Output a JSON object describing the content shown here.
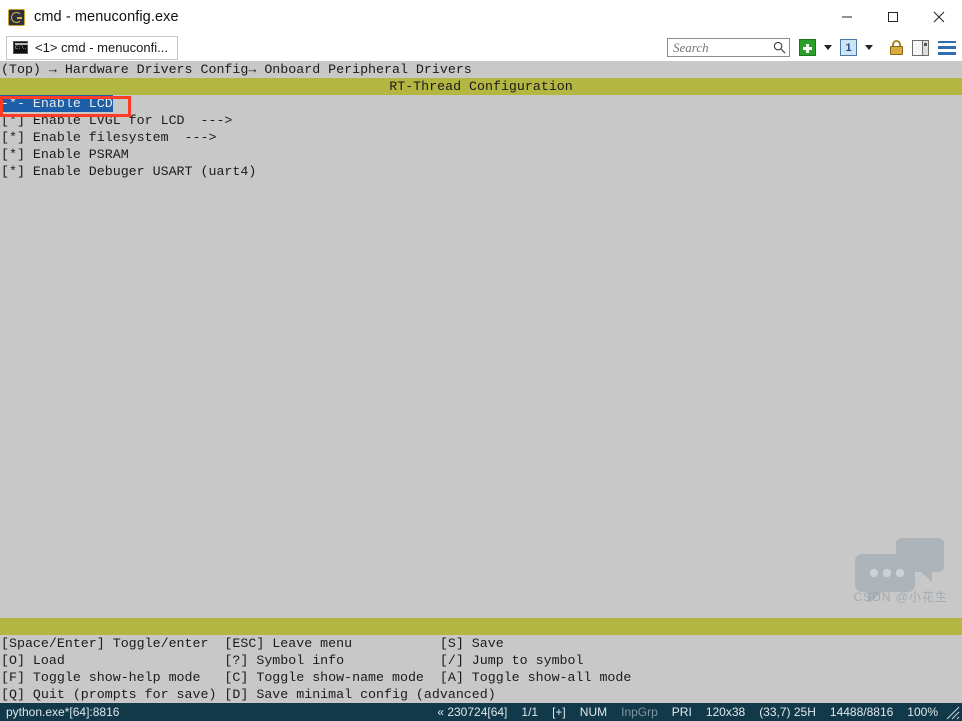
{
  "window": {
    "title": "cmd - menuconfig.exe",
    "app_icon": "conemu-icon",
    "minimize_label": "Minimize",
    "maximize_label": "Maximize",
    "close_label": "Close"
  },
  "tabstrip": {
    "tab_label": "<1> cmd - menuconfi...",
    "tab_icon": "console-icon"
  },
  "toolbar": {
    "search_placeholder": "Search",
    "search_value": "",
    "new_console_label": "+",
    "new_console_icon": "green-plus-icon",
    "new_console_caret": "chevron-down-icon",
    "active_console_label": "1",
    "active_console_icon": "numbered-tab-icon",
    "active_console_caret": "chevron-down-icon",
    "lock_icon": "lock-icon",
    "split_icon": "split-pane-icon",
    "menu_icon": "hamburger-menu-icon"
  },
  "console": {
    "breadcrumb": "(Top) → Hardware Drivers Config→ Onboard Peripheral Drivers",
    "banner": "RT-Thread Configuration",
    "menu_items": [
      {
        "prefix": "-*-",
        "label": "Enable LCD",
        "submenu": "",
        "selected": true
      },
      {
        "prefix": "[*]",
        "label": "Enable LVGL for LCD",
        "submenu": "--->",
        "selected": false
      },
      {
        "prefix": "[*]",
        "label": "Enable filesystem",
        "submenu": "--->",
        "selected": false
      },
      {
        "prefix": "[*]",
        "label": "Enable PSRAM",
        "submenu": "",
        "selected": false
      },
      {
        "prefix": "[*]",
        "label": "Enable Debuger USART (uart4)",
        "submenu": "",
        "selected": false
      }
    ],
    "annotation": {
      "name": "red-highlight-box",
      "color": "#fe3b26"
    },
    "watermark_text": "CSDN @小花生",
    "colors": {
      "background": "#c8c8c8",
      "banner": "#b4b642",
      "selection": "#1c5fa8",
      "text": "#1b1b1b"
    }
  },
  "help": {
    "rows": [
      "[Space/Enter] Toggle/enter  [ESC] Leave menu           [S] Save",
      "[O] Load                    [?] Symbol info            [/] Jump to symbol",
      "[F] Toggle show-help mode   [C] Toggle show-name mode  [A] Toggle show-all mode",
      "[Q] Quit (prompts for save) [D] Save minimal config (advanced)"
    ]
  },
  "statusbar": {
    "process": "python.exe*[64]:8816",
    "build": "« 230724[64]",
    "pages": "1/1",
    "insert": "[+]",
    "num": "NUM",
    "inpgrp": "InpGrp",
    "pri": "PRI",
    "size": "120x38",
    "cursor": "(33,7) 25H",
    "buffer": "14488/8816",
    "zoom": "100%"
  }
}
